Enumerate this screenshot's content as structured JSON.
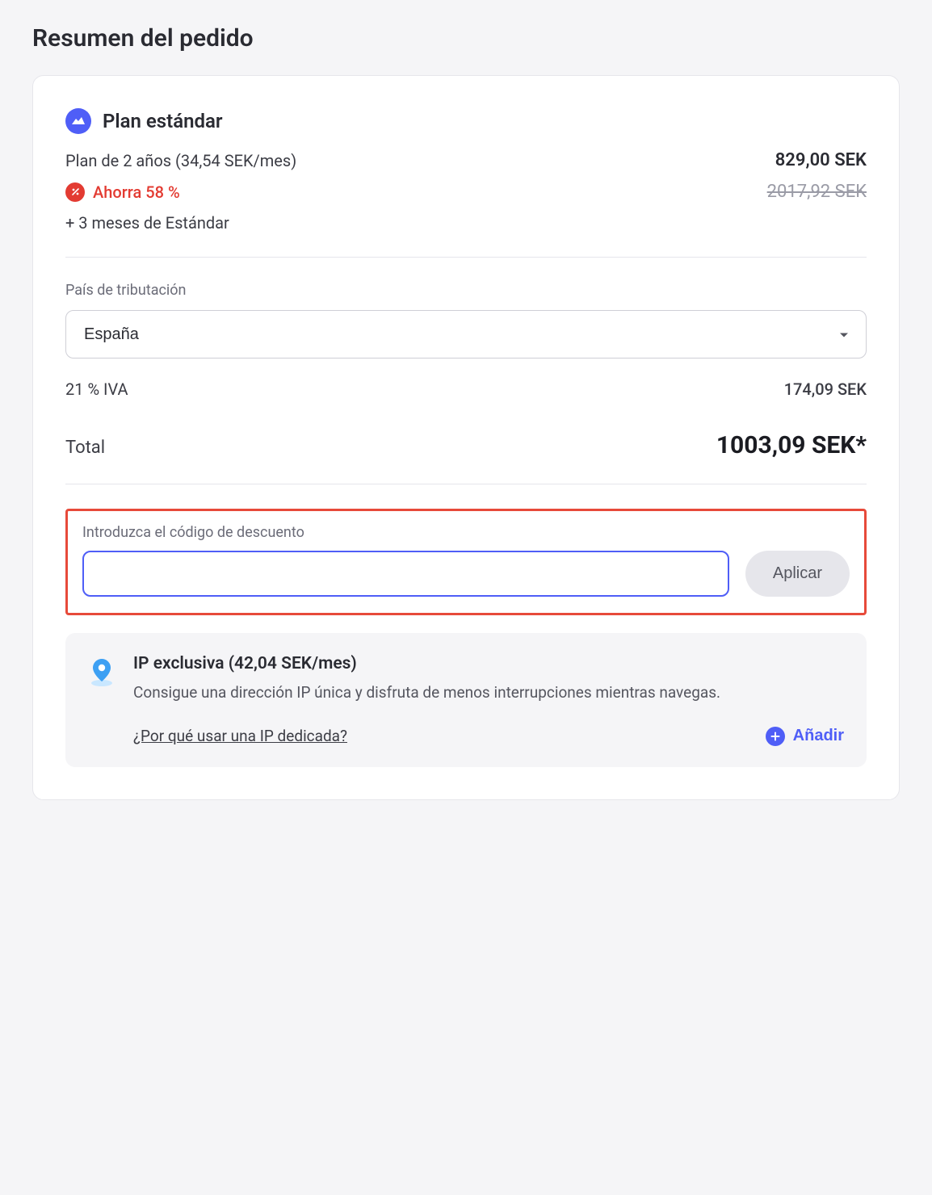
{
  "page_title": "Resumen del pedido",
  "plan": {
    "name": "Plan estándar",
    "description": "Plan de 2 años (34,54 SEK/mes)",
    "price": "829,00 SEK",
    "savings_label": "Ahorra 58 %",
    "original_price": "2017,92 SEK",
    "bonus": "+ 3 meses de Estándar"
  },
  "tax": {
    "section_label": "País de tributación",
    "country": "España",
    "vat_label": "21 % IVA",
    "vat_amount": "174,09 SEK"
  },
  "total": {
    "label": "Total",
    "amount": "1003,09 SEK*"
  },
  "coupon": {
    "label": "Introduzca el código de descuento",
    "value": "",
    "apply_label": "Aplicar"
  },
  "addon": {
    "title": "IP exclusiva (42,04 SEK/mes)",
    "description": "Consigue una dirección IP única y disfruta de menos interrupciones mientras navegas.",
    "link": "¿Por qué usar una IP dedicada?",
    "add_label": "Añadir"
  }
}
